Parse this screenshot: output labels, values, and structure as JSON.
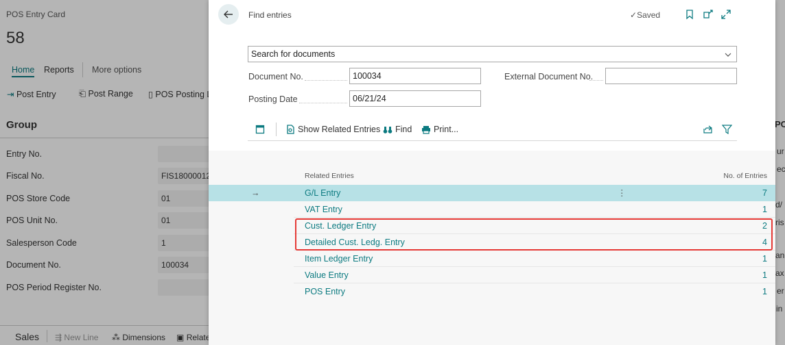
{
  "card": {
    "caption": "POS Entry Card",
    "number": "58",
    "tabs": [
      "Home",
      "Reports",
      "More options"
    ],
    "actions": [
      "Post Entry",
      "Post Range",
      "POS Posting L"
    ],
    "group_title": "Group",
    "fields": [
      {
        "label": "Entry No.",
        "value": ""
      },
      {
        "label": "Fiscal No.",
        "value": "FIS18000012"
      },
      {
        "label": "POS Store Code",
        "value": "01"
      },
      {
        "label": "POS Unit No.",
        "value": "01"
      },
      {
        "label": "Salesperson Code",
        "value": "1"
      },
      {
        "label": "Document No.",
        "value": "100034"
      },
      {
        "label": "POS Period Register No.",
        "value": ""
      }
    ],
    "bottom_bar": {
      "title": "Sales",
      "new_line": "New Line",
      "dimensions": "Dimensions",
      "related": "Relate"
    },
    "right_edge": [
      "PO",
      "ur",
      "ec",
      "d/",
      "ris",
      "an",
      "ax",
      "er",
      "in"
    ]
  },
  "dialog": {
    "title": "Find entries",
    "status": "Saved",
    "search": {
      "value": "Search for documents"
    },
    "document_no": {
      "label": "Document No.",
      "value": "100034"
    },
    "external_document_no": {
      "label": "External Document No.",
      "value": ""
    },
    "posting_date": {
      "label": "Posting Date",
      "value": "06/21/24"
    },
    "toolbar": {
      "show_related": "Show Related Entries",
      "find": "Find",
      "print": "Print..."
    },
    "table": {
      "col_related": "Related Entries",
      "col_count": "No. of Entries",
      "rows": [
        {
          "name": "G/L Entry",
          "count": "7"
        },
        {
          "name": "VAT Entry",
          "count": "1"
        },
        {
          "name": "Cust. Ledger Entry",
          "count": "2"
        },
        {
          "name": "Detailed Cust. Ledg. Entry",
          "count": "4"
        },
        {
          "name": "Item Ledger Entry",
          "count": "1"
        },
        {
          "name": "Value Entry",
          "count": "1"
        },
        {
          "name": "POS Entry",
          "count": "1"
        }
      ]
    },
    "highlight_color": "#e53935",
    "accent_color": "#0b7a80"
  }
}
